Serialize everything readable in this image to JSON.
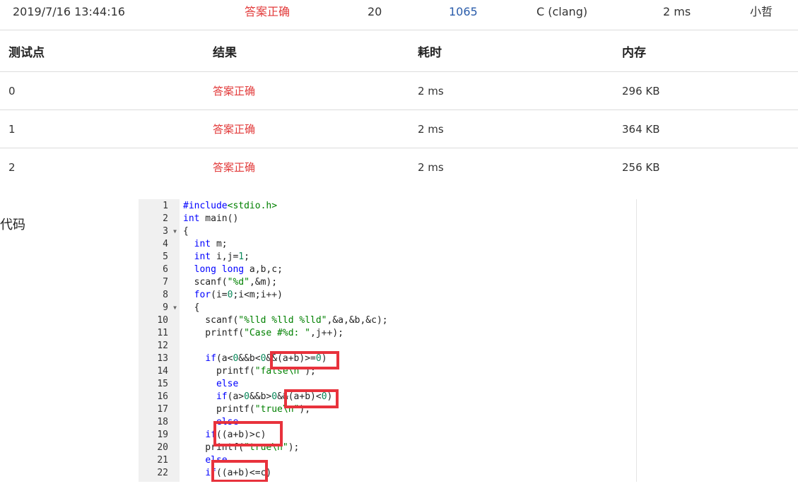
{
  "submission": {
    "time": "2019/7/16 13:44:16",
    "result": "答案正确",
    "score": "20",
    "problem_id": "1065",
    "language": "C (clang)",
    "duration": "2 ms",
    "user": "小哲"
  },
  "testcases": {
    "headers": [
      "测试点",
      "结果",
      "耗时",
      "内存"
    ],
    "rows": [
      {
        "id": "0",
        "result": "答案正确",
        "time": "2 ms",
        "memory": "296 KB"
      },
      {
        "id": "1",
        "result": "答案正确",
        "time": "2 ms",
        "memory": "364 KB"
      },
      {
        "id": "2",
        "result": "答案正确",
        "time": "2 ms",
        "memory": "256 KB"
      }
    ]
  },
  "code": {
    "label": "代码",
    "lines": [
      {
        "n": "1",
        "fold": ""
      },
      {
        "n": "2",
        "fold": ""
      },
      {
        "n": "3",
        "fold": "▼"
      },
      {
        "n": "4",
        "fold": ""
      },
      {
        "n": "5",
        "fold": ""
      },
      {
        "n": "6",
        "fold": ""
      },
      {
        "n": "7",
        "fold": ""
      },
      {
        "n": "8",
        "fold": ""
      },
      {
        "n": "9",
        "fold": "▼"
      },
      {
        "n": "10",
        "fold": ""
      },
      {
        "n": "11",
        "fold": ""
      },
      {
        "n": "12",
        "fold": ""
      },
      {
        "n": "13",
        "fold": ""
      },
      {
        "n": "14",
        "fold": ""
      },
      {
        "n": "15",
        "fold": ""
      },
      {
        "n": "16",
        "fold": ""
      },
      {
        "n": "17",
        "fold": ""
      },
      {
        "n": "18",
        "fold": ""
      },
      {
        "n": "19",
        "fold": ""
      },
      {
        "n": "20",
        "fold": ""
      },
      {
        "n": "21",
        "fold": ""
      },
      {
        "n": "22",
        "fold": ""
      }
    ],
    "text": [
      [
        [
          "#include",
          "kw"
        ],
        [
          "<stdio.h>",
          "str"
        ]
      ],
      [
        [
          "int",
          "kw"
        ],
        [
          " main()",
          ""
        ]
      ],
      [
        [
          "{",
          ""
        ]
      ],
      [
        [
          "  ",
          ""
        ],
        [
          "int",
          "kw"
        ],
        [
          " m;",
          ""
        ]
      ],
      [
        [
          "  ",
          ""
        ],
        [
          "int",
          "kw"
        ],
        [
          " i,j=",
          ""
        ],
        [
          "1",
          "num"
        ],
        [
          ";",
          ""
        ]
      ],
      [
        [
          "  ",
          ""
        ],
        [
          "long long",
          "kw"
        ],
        [
          " a,b,c;",
          ""
        ]
      ],
      [
        [
          "  scanf(",
          ""
        ],
        [
          "\"%d\"",
          "str"
        ],
        [
          ",&m);",
          ""
        ]
      ],
      [
        [
          "  ",
          ""
        ],
        [
          "for",
          "kw"
        ],
        [
          "(i=",
          ""
        ],
        [
          "0",
          "num"
        ],
        [
          ";i<m;i",
          ""
        ],
        [
          "++",
          "op"
        ],
        [
          ")",
          ""
        ]
      ],
      [
        [
          "  {",
          ""
        ]
      ],
      [
        [
          "    scanf(",
          ""
        ],
        [
          "\"%lld %lld %lld\"",
          "str"
        ],
        [
          ",&a,&b,&c);",
          ""
        ]
      ],
      [
        [
          "    printf(",
          ""
        ],
        [
          "\"Case #%d: \"",
          "str"
        ],
        [
          ",j",
          ""
        ],
        [
          "++",
          "op"
        ],
        [
          ");",
          ""
        ]
      ],
      [
        [
          "",
          ""
        ]
      ],
      [
        [
          "    ",
          ""
        ],
        [
          "if",
          "kw"
        ],
        [
          "(a<",
          ""
        ],
        [
          "0",
          "num"
        ],
        [
          "&&b<",
          ""
        ],
        [
          "0",
          "num"
        ],
        [
          "&&(a+b)>=",
          ""
        ],
        [
          "0",
          "num"
        ],
        [
          ")",
          ""
        ]
      ],
      [
        [
          "      printf(",
          ""
        ],
        [
          "\"false\\n\"",
          "str"
        ],
        [
          ");",
          ""
        ]
      ],
      [
        [
          "      ",
          ""
        ],
        [
          "else",
          "kw"
        ]
      ],
      [
        [
          "      ",
          ""
        ],
        [
          "if",
          "kw"
        ],
        [
          "(a>",
          ""
        ],
        [
          "0",
          "num"
        ],
        [
          "&&b>",
          ""
        ],
        [
          "0",
          "num"
        ],
        [
          "&&(a+b)<",
          ""
        ],
        [
          "0",
          "num"
        ],
        [
          ")",
          ""
        ]
      ],
      [
        [
          "      printf(",
          ""
        ],
        [
          "\"true\\n\"",
          "str"
        ],
        [
          ");",
          ""
        ]
      ],
      [
        [
          "      ",
          ""
        ],
        [
          "else",
          "kw"
        ]
      ],
      [
        [
          "    ",
          ""
        ],
        [
          "if",
          "kw"
        ],
        [
          "((a+b)>c)",
          ""
        ]
      ],
      [
        [
          "    printf(",
          ""
        ],
        [
          "\"true\\n\"",
          "str"
        ],
        [
          ");",
          ""
        ]
      ],
      [
        [
          "    ",
          ""
        ],
        [
          "else",
          "kw"
        ]
      ],
      [
        [
          "    ",
          ""
        ],
        [
          "if",
          "kw"
        ],
        [
          "((a+b)<=c)",
          ""
        ]
      ]
    ]
  },
  "colors": {
    "keyword": "#0000ff",
    "string": "#008000",
    "number": "#09885a",
    "operator": "#333333",
    "accepted": "#e23a3a",
    "highlight": "#e8323c"
  }
}
